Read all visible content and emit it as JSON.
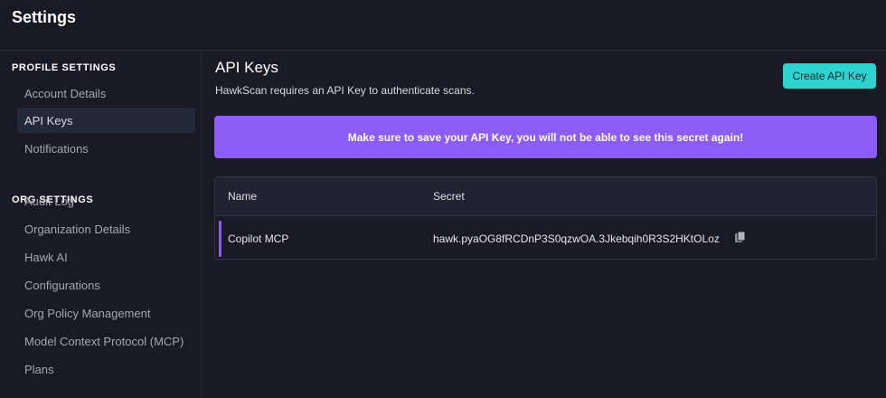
{
  "header": {
    "title": "Settings"
  },
  "sidebar": {
    "sections": [
      {
        "title": "PROFILE SETTINGS",
        "items": [
          {
            "label": "Account Details",
            "active": false
          },
          {
            "label": "API Keys",
            "active": true
          },
          {
            "label": "Notifications",
            "active": false
          }
        ]
      },
      {
        "title": "ORG SETTINGS",
        "items": [
          {
            "label": "Audit Log",
            "active": false
          },
          {
            "label": "Organization Details",
            "active": false
          },
          {
            "label": "Hawk AI",
            "active": false
          },
          {
            "label": "Configurations",
            "active": false
          },
          {
            "label": "Org Policy Management",
            "active": false
          },
          {
            "label": "Model Context Protocol (MCP)",
            "active": false
          },
          {
            "label": "Plans",
            "active": false
          }
        ]
      }
    ]
  },
  "main": {
    "heading": "API Keys",
    "description": "HawkScan requires an API Key to authenticate scans.",
    "create_button": "Create API Key",
    "warning": "Make sure to save your API Key, you will not be able to see this secret again!",
    "table": {
      "columns": [
        "Name",
        "Secret"
      ],
      "rows": [
        {
          "name": "Copilot MCP",
          "secret": "hawk.pyaOG8fRCDnP3S0qzwOA.3Jkebqih0R3S2HKtOLoz",
          "copy_icon": "copy-icon"
        }
      ]
    }
  },
  "colors": {
    "background": "#1a1a24",
    "accent_teal": "#2dd4cf",
    "accent_purple": "#8b5cf6",
    "active_nav": "#24293a"
  }
}
